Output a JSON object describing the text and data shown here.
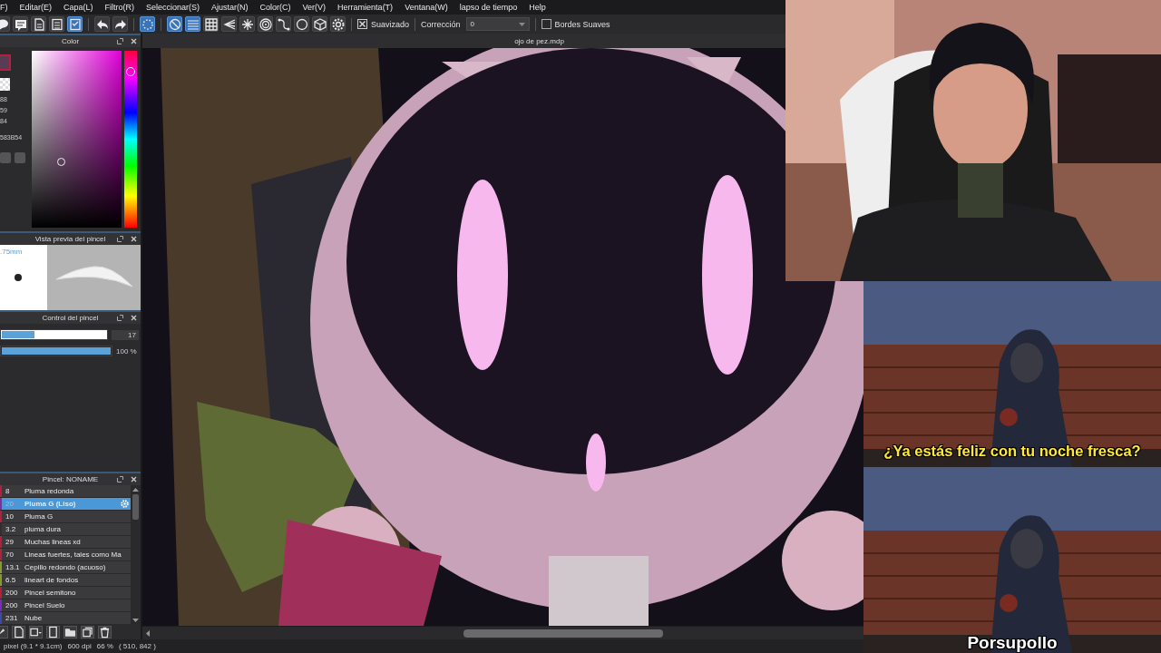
{
  "menu": [
    "F)",
    "Editar(E)",
    "Capa(L)",
    "Filtro(R)",
    "Seleccionar(S)",
    "Ajustar(N)",
    "Color(C)",
    "Ver(V)",
    "Herramienta(T)",
    "Ventana(W)",
    "lapso de tiempo",
    "Help"
  ],
  "toolbar": {
    "tools": [
      {
        "kind": "speech",
        "selected": false
      },
      {
        "kind": "comment",
        "selected": false
      },
      {
        "kind": "page",
        "selected": false
      },
      {
        "kind": "list",
        "selected": false
      },
      {
        "kind": "checklist",
        "selected": true
      },
      {
        "kind": "undo",
        "selected": false
      },
      {
        "kind": "redo",
        "selected": false
      },
      {
        "kind": "selection",
        "selected": true
      },
      {
        "kind": "circle-slash",
        "selected": true
      },
      {
        "kind": "lines",
        "selected": true
      },
      {
        "kind": "grid",
        "selected": false
      },
      {
        "kind": "perspective",
        "selected": false
      },
      {
        "kind": "radial",
        "selected": false
      },
      {
        "kind": "concentric",
        "selected": false
      },
      {
        "kind": "curve",
        "selected": false
      },
      {
        "kind": "circle",
        "selected": false
      },
      {
        "kind": "cube",
        "selected": false
      },
      {
        "kind": "gear",
        "selected": false
      }
    ],
    "antialias": {
      "label": "Suavizado",
      "checked": true
    },
    "correction": {
      "label": "Corrección",
      "value": "0"
    },
    "soft_edges": {
      "label": "Bordes Suaves",
      "checked": false
    }
  },
  "color_panel": {
    "title": "Color",
    "values": [
      "88",
      "59",
      "84"
    ],
    "hex": "583B54",
    "hue": {
      "level": 0.88
    }
  },
  "brush_preview": {
    "title": "Vista previa del pincel",
    "size": ".75mm"
  },
  "brush_control": {
    "title": "Control del pincel",
    "sliders": [
      {
        "level": 0.31,
        "reading": "17"
      },
      {
        "level": 1.0,
        "reading": "100 %"
      }
    ]
  },
  "brush_list": {
    "title": "Pincel: NONAME",
    "items": [
      {
        "size": "8",
        "name": "Pluma redonda",
        "color": "#b3203c",
        "selected": false
      },
      {
        "size": "20",
        "name": "Pluma G (Liso)",
        "color": "#8a2a9a",
        "selected": true
      },
      {
        "size": "10",
        "name": "Pluma G",
        "color": "#b3203c",
        "selected": false
      },
      {
        "size": "3.2",
        "name": "pluma dura",
        "color": "#3a2a2a",
        "selected": false
      },
      {
        "size": "29",
        "name": "Muchas lineas xd",
        "color": "#b3203c",
        "selected": false
      },
      {
        "size": "70",
        "name": "Lineas fuertes, tales como Ma",
        "color": "#b3203c",
        "selected": false
      },
      {
        "size": "13.1",
        "name": "Cepillo redondo (acuoso)",
        "color": "#8a9a2a",
        "selected": false
      },
      {
        "size": "6.5",
        "name": "lineart de fondos",
        "color": "#8a9a2a",
        "selected": false
      },
      {
        "size": "200",
        "name": "Pincel semitono",
        "color": "#b3203c",
        "selected": false
      },
      {
        "size": "200",
        "name": "Pincel Suelo",
        "color": "#7a2ac0",
        "selected": false
      },
      {
        "size": "231",
        "name": "Nube",
        "color": "#3a4ab0",
        "selected": false
      }
    ]
  },
  "canvas": {
    "tab": "ojo de pez.mdp"
  },
  "status_bar": [
    "pixel (9.1 * 9.1cm)",
    "600 dpi",
    "66 %",
    "( 510, 842 )"
  ],
  "meme": {
    "captions": [
      "¿Ya estás feliz con tu noche fresca?",
      "Porsupollo"
    ]
  }
}
